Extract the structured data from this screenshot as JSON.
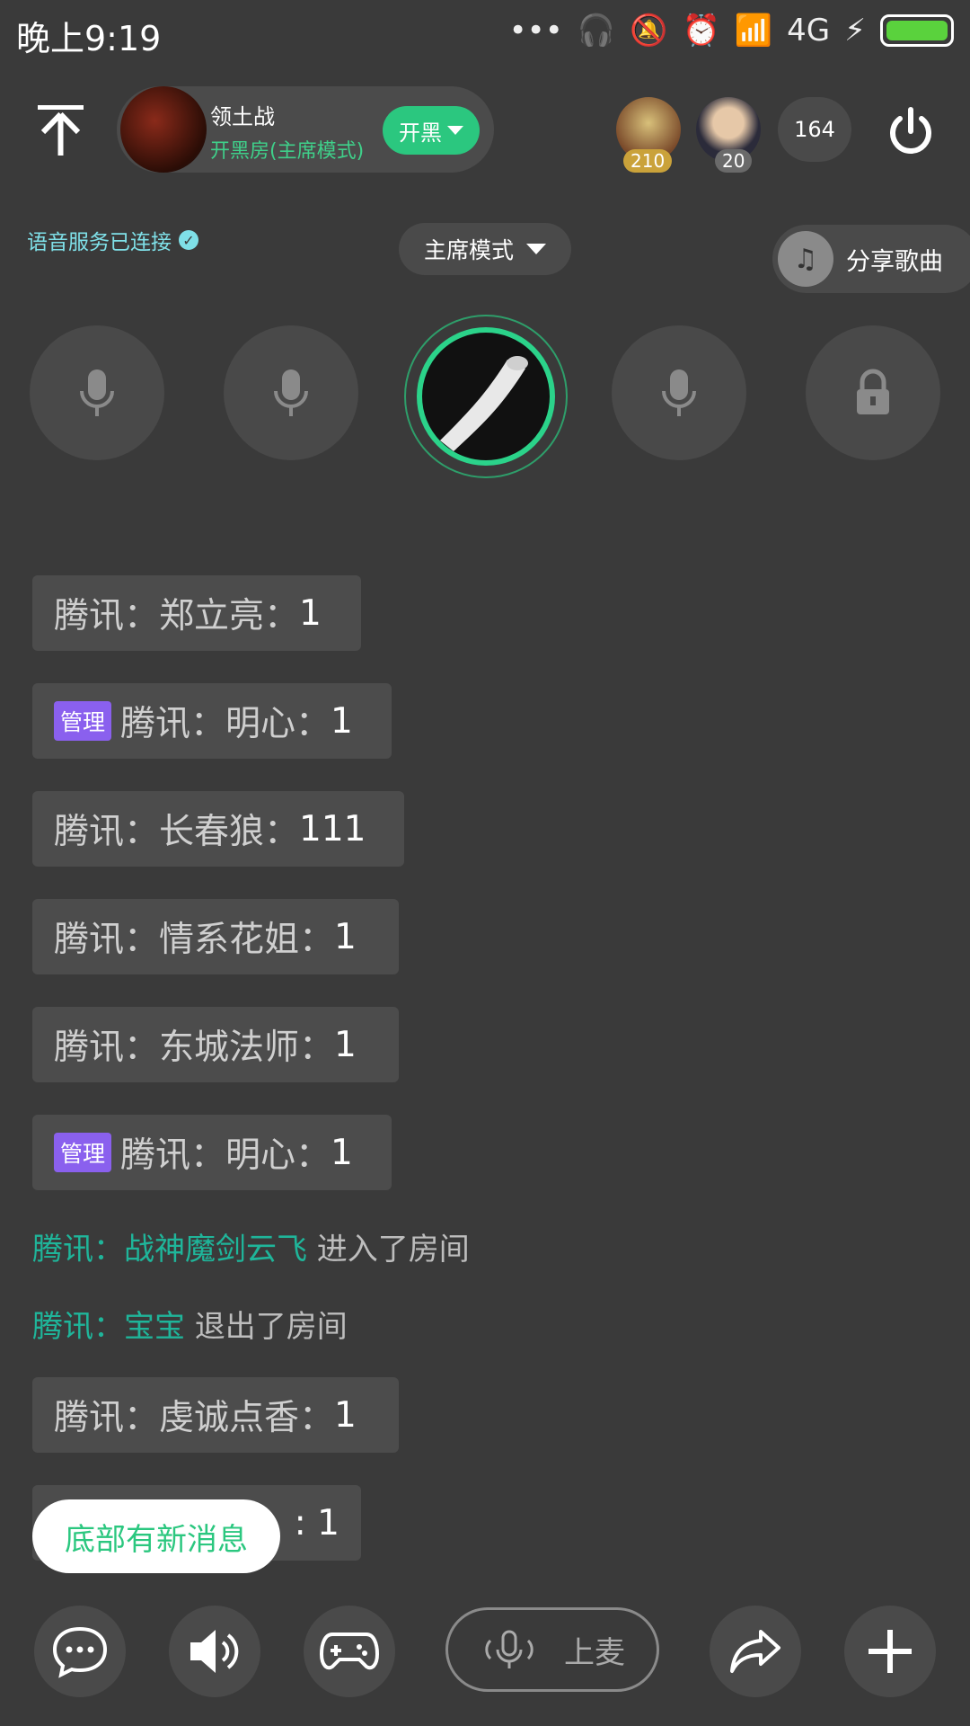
{
  "status_bar": {
    "time": "晚上9:19",
    "network": "4G"
  },
  "header": {
    "room_title": "领土战",
    "room_subtitle": "开黑房(主席模式)",
    "kaihei_label": "开黑",
    "avatar1_badge": "210",
    "avatar2_badge": "20",
    "online_count": "164"
  },
  "voice_status": "语音服务已连接",
  "mode_label": "主席模式",
  "share_label": "分享歌曲",
  "chat": {
    "admin_tag": "管理",
    "messages": [
      {
        "text": "腾讯：郑立亮：",
        "num": "1"
      },
      {
        "text": "腾讯：明心：",
        "num": "1"
      },
      {
        "text": "腾讯：长春狼：",
        "num": "111"
      },
      {
        "text": "腾讯：情系花姐：",
        "num": "1"
      },
      {
        "text": "腾讯：东城法师：",
        "num": "1"
      },
      {
        "text": "腾讯：明心：",
        "num": "1"
      },
      {
        "text": "腾讯：虔诚点香：",
        "num": "1"
      },
      {
        "text": "",
        "num": ":  1"
      }
    ],
    "system": [
      {
        "name": "腾讯：战神魔剑云飞",
        "action": " 进入了房间"
      },
      {
        "name": "腾讯：宝宝",
        "action": " 退出了房间"
      }
    ]
  },
  "new_message_label": "底部有新消息",
  "mic_label": "上麦",
  "colors": {
    "accent": "#2bc77f",
    "background": "#3a3a3a",
    "admin_tag": "#8a60ee"
  }
}
